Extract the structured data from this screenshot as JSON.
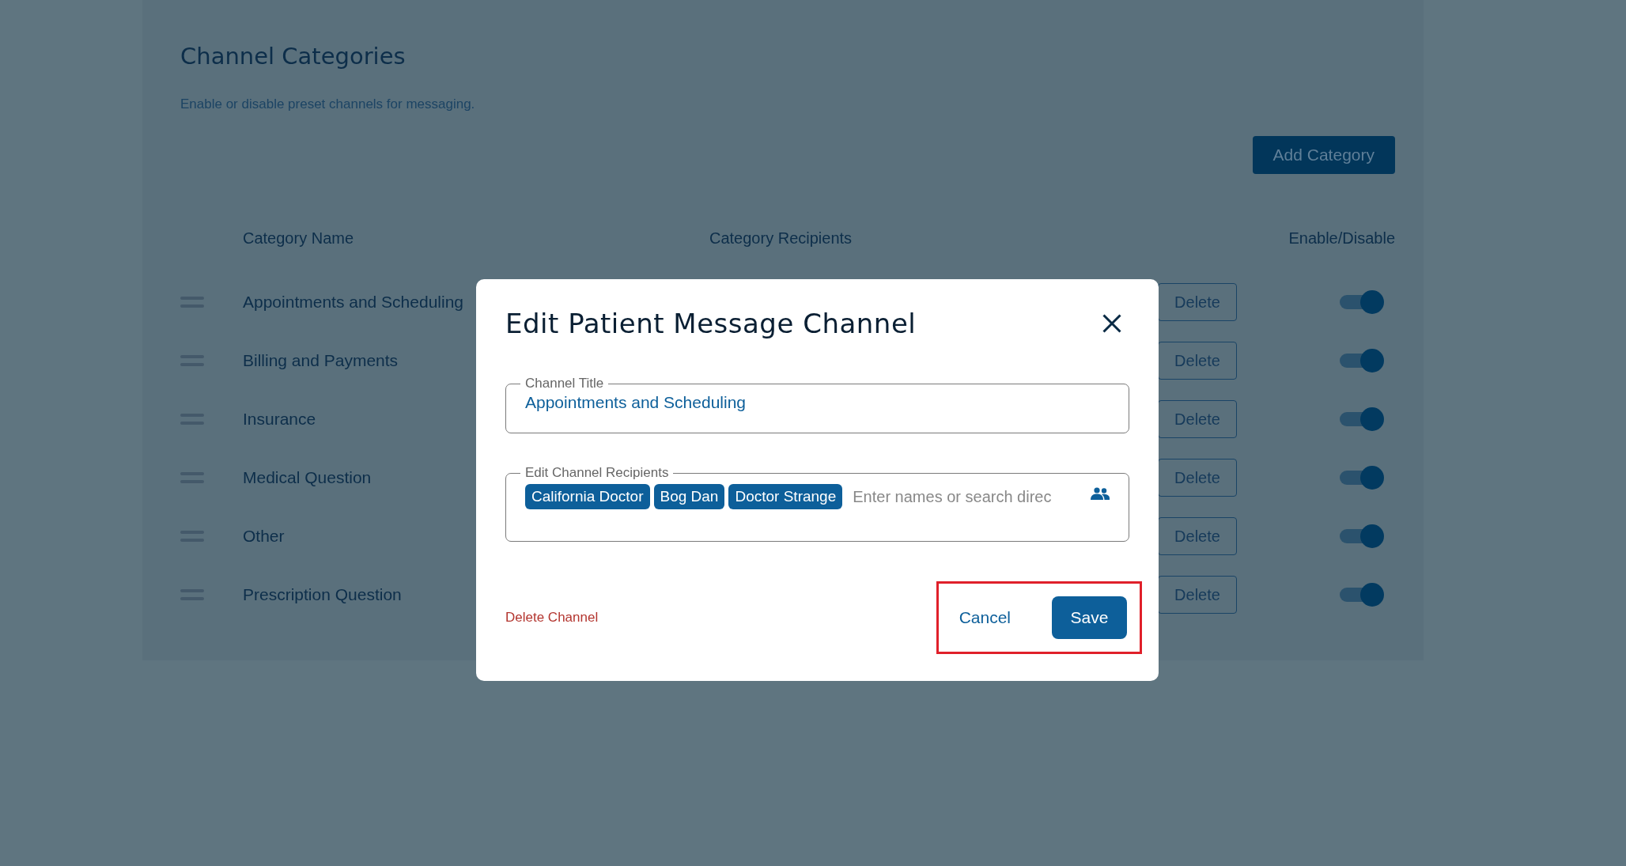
{
  "page": {
    "title": "Channel Categories",
    "subtitle": "Enable or disable preset channels for messaging.",
    "add_button": "Add Category"
  },
  "table": {
    "columns": [
      "Category Name",
      "Category Recipients",
      "Enable/Disable"
    ],
    "rows": [
      {
        "name": "Appointments and Scheduling",
        "action": "Delete",
        "enabled": true
      },
      {
        "name": "Billing and Payments",
        "action": "Delete",
        "enabled": true
      },
      {
        "name": "Insurance",
        "action": "Delete",
        "enabled": true
      },
      {
        "name": "Medical Question",
        "action": "Delete",
        "enabled": true
      },
      {
        "name": "Other",
        "action": "Delete",
        "enabled": true
      },
      {
        "name": "Prescription Question",
        "action": "Delete",
        "enabled": true
      }
    ]
  },
  "dialog": {
    "title": "Edit Patient Message Channel",
    "title_field": {
      "label": "Channel Title",
      "value": "Appointments and Scheduling"
    },
    "recipients_field": {
      "label": "Edit Channel Recipients",
      "chips": [
        "California Doctor",
        "Bog Dan",
        "Doctor Strange"
      ],
      "placeholder": "Enter names or search direc"
    },
    "delete_link": "Delete Channel",
    "cancel": "Cancel",
    "save": "Save"
  }
}
